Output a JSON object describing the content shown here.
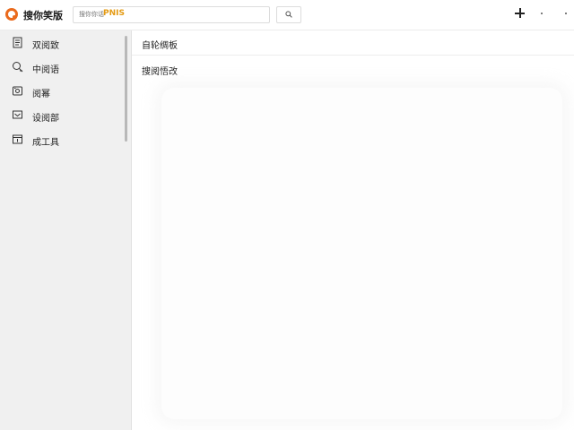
{
  "app": {
    "title": "搜你笑版",
    "logo_color": "#ea6a1c"
  },
  "search": {
    "prefix": "搜你你话",
    "value": "PNIS",
    "value_color": "#e49a12",
    "button_icon": "search-icon"
  },
  "toolbar": {
    "add_icon": "plus-icon"
  },
  "sidebar": {
    "items": [
      {
        "label": "双阅致",
        "icon": "document-icon"
      },
      {
        "label": "中阅语",
        "icon": "search-add-icon"
      },
      {
        "label": "阅幂",
        "icon": "gallery-icon"
      },
      {
        "label": "设阅部",
        "icon": "message-icon"
      },
      {
        "label": "成工具",
        "icon": "tool-icon"
      }
    ]
  },
  "main": {
    "title": "自轮绸板",
    "subtitle": "搜阅悟改"
  }
}
